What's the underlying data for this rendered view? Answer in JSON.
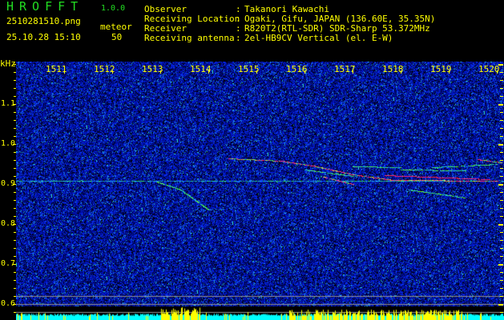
{
  "app": {
    "title": "HROFFT",
    "version": "1.0.0"
  },
  "file": {
    "name": "2510281510.png",
    "datetime": "25.10.28 15:10"
  },
  "detection": {
    "label": "meteor",
    "count": "50"
  },
  "info": [
    {
      "label": "Observer",
      "value": "Takanori Kawachi"
    },
    {
      "label": "Receiving Location",
      "value": "Ogaki, Gifu, JAPAN (136.60E, 35.35N)"
    },
    {
      "label": "Receiver",
      "value": "R820T2(RTL-SDR) SDR-Sharp 53.372MHz"
    },
    {
      "label": "Receiving antenna",
      "value": "2el-HB9CV Vertical (el. E-W)"
    }
  ],
  "axis": {
    "y_unit": "kHz",
    "y_labels": [
      "1.1",
      "1.0",
      "0.9",
      "0.8",
      "0.7",
      "0.6"
    ],
    "x_labels": [
      "1511",
      "1512",
      "1513",
      "1514",
      "1515",
      "1516",
      "1517",
      "1518",
      "1519",
      "1520"
    ]
  },
  "colors": {
    "text": "#ffff00",
    "title": "#22dd22",
    "noise": "#0010c0",
    "bars": "#00ffff"
  }
}
